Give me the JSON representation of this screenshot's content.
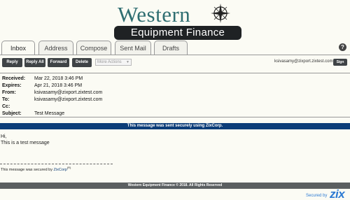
{
  "brand": {
    "line1": "Western",
    "line2": "Equipment Finance",
    "color_primary": "#2f6e71",
    "bar_color": "#1f2224"
  },
  "tabs": [
    {
      "label": "Inbox",
      "active": true
    },
    {
      "label": "Address",
      "active": false
    },
    {
      "label": "Compose",
      "active": false
    },
    {
      "label": "Sent Mail",
      "active": false
    },
    {
      "label": "Drafts",
      "active": false
    }
  ],
  "help_label": "?",
  "toolbar": {
    "reply": "Reply",
    "reply_all": "Reply All",
    "forward": "Forward",
    "delete": "Delete",
    "more_actions": "More Actions",
    "user_email": "ksivasamy@zixport.zixtest.com",
    "sign_out": "Sign Out"
  },
  "message": {
    "received_label": "Received:",
    "received": "Mar 22, 2018 3:46 PM",
    "expires_label": "Expires:",
    "expires": "Apr 21, 2018 3:46 PM",
    "from_label": "From:",
    "from": "ksivasamy@zixport.zixtest.com",
    "to_label": "To:",
    "to": "ksivasamy@zixport.zixtest.com",
    "cc_label": "Cc:",
    "cc": "",
    "subject_label": "Subject:",
    "subject": "Test Message",
    "secure_banner": "This message was sent securely using ZixCorp.",
    "body_line1": "Hi,",
    "body_line2": "This is a test message",
    "secured_by_text": "This message was secured by ",
    "secured_by_brand": "ZixCorp",
    "secured_by_mark": "(R)"
  },
  "footer": {
    "copyright": "Western Equipment Finance © 2018. All Rights Reserved",
    "secured_by": "Secured by",
    "zix": "zix"
  },
  "colors": {
    "banner": "#0c3d78",
    "button": "#3f4346",
    "footer": "#5b5f61",
    "zix_blue": "#2e7bd3"
  }
}
